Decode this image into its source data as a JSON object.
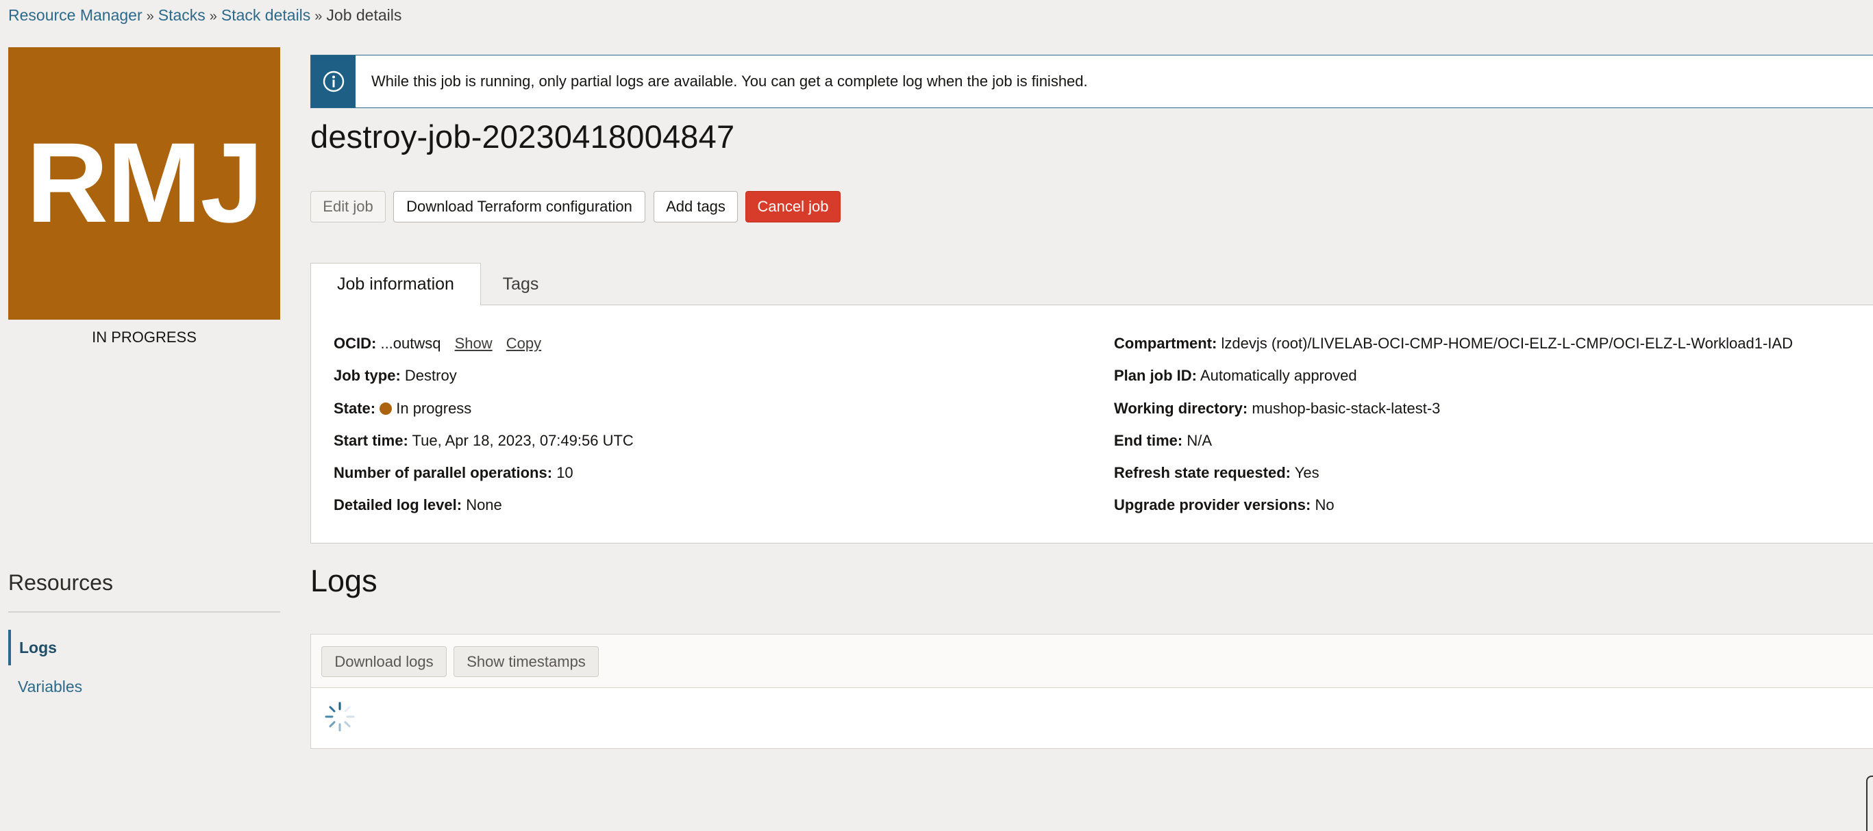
{
  "breadcrumb": {
    "items": [
      "Resource Manager",
      "Stacks",
      "Stack details"
    ],
    "current": "Job details",
    "separator": "»"
  },
  "badge": {
    "initials": "RMJ",
    "status": "IN PROGRESS",
    "color": "#ac630e"
  },
  "banner": {
    "icon": "info-icon",
    "text": "While this job is running, only partial logs are available. You can get a complete log when the job is finished."
  },
  "job": {
    "title": "destroy-job-20230418004847"
  },
  "actions": {
    "edit": "Edit job",
    "download_tf": "Download Terraform configuration",
    "add_tags": "Add tags",
    "cancel": "Cancel job"
  },
  "tabs": [
    {
      "label": "Job information",
      "active": true
    },
    {
      "label": "Tags",
      "active": false
    }
  ],
  "info": {
    "ocid": {
      "label": "OCID:",
      "value": "...outwsq",
      "show": "Show",
      "copy": "Copy"
    },
    "job_type": {
      "label": "Job type:",
      "value": "Destroy"
    },
    "state": {
      "label": "State:",
      "value": "In progress",
      "color": "#ac630e"
    },
    "start_time": {
      "label": "Start time:",
      "value": "Tue, Apr 18, 2023, 07:49:56 UTC"
    },
    "parallel_ops": {
      "label": "Number of parallel operations:",
      "value": "10"
    },
    "log_level": {
      "label": "Detailed log level:",
      "value": "None"
    },
    "compartment": {
      "label": "Compartment:",
      "value": "lzdevjs (root)/LIVELAB-OCI-CMP-HOME/OCI-ELZ-L-CMP/OCI-ELZ-L-Workload1-IAD"
    },
    "plan_job_id": {
      "label": "Plan job ID:",
      "value": "Automatically approved"
    },
    "working_dir": {
      "label": "Working directory:",
      "value": "mushop-basic-stack-latest-3"
    },
    "end_time": {
      "label": "End time:",
      "value": "N/A"
    },
    "refresh_state": {
      "label": "Refresh state requested:",
      "value": "Yes"
    },
    "upgrade_providers": {
      "label": "Upgrade provider versions:",
      "value": "No"
    }
  },
  "resources": {
    "title": "Resources",
    "items": [
      {
        "label": "Logs",
        "active": true
      },
      {
        "label": "Variables",
        "active": false
      }
    ]
  },
  "logs": {
    "title": "Logs",
    "download": "Download logs",
    "timestamps": "Show timestamps"
  }
}
